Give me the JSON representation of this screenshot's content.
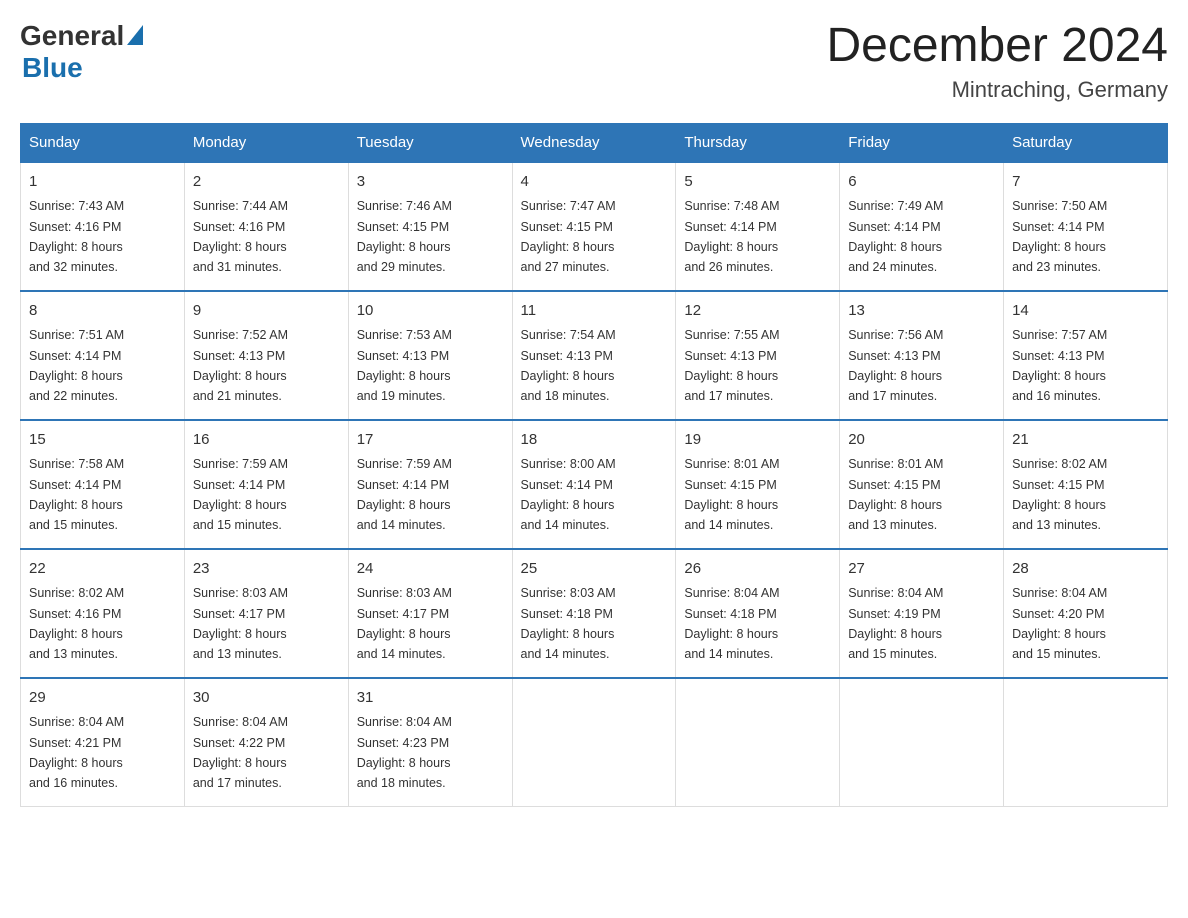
{
  "header": {
    "title": "December 2024",
    "subtitle": "Mintraching, Germany",
    "logo_general": "General",
    "logo_blue": "Blue"
  },
  "days_of_week": [
    "Sunday",
    "Monday",
    "Tuesday",
    "Wednesday",
    "Thursday",
    "Friday",
    "Saturday"
  ],
  "weeks": [
    [
      {
        "day": "1",
        "sunrise": "Sunrise: 7:43 AM",
        "sunset": "Sunset: 4:16 PM",
        "daylight": "Daylight: 8 hours",
        "daylight2": "and 32 minutes."
      },
      {
        "day": "2",
        "sunrise": "Sunrise: 7:44 AM",
        "sunset": "Sunset: 4:16 PM",
        "daylight": "Daylight: 8 hours",
        "daylight2": "and 31 minutes."
      },
      {
        "day": "3",
        "sunrise": "Sunrise: 7:46 AM",
        "sunset": "Sunset: 4:15 PM",
        "daylight": "Daylight: 8 hours",
        "daylight2": "and 29 minutes."
      },
      {
        "day": "4",
        "sunrise": "Sunrise: 7:47 AM",
        "sunset": "Sunset: 4:15 PM",
        "daylight": "Daylight: 8 hours",
        "daylight2": "and 27 minutes."
      },
      {
        "day": "5",
        "sunrise": "Sunrise: 7:48 AM",
        "sunset": "Sunset: 4:14 PM",
        "daylight": "Daylight: 8 hours",
        "daylight2": "and 26 minutes."
      },
      {
        "day": "6",
        "sunrise": "Sunrise: 7:49 AM",
        "sunset": "Sunset: 4:14 PM",
        "daylight": "Daylight: 8 hours",
        "daylight2": "and 24 minutes."
      },
      {
        "day": "7",
        "sunrise": "Sunrise: 7:50 AM",
        "sunset": "Sunset: 4:14 PM",
        "daylight": "Daylight: 8 hours",
        "daylight2": "and 23 minutes."
      }
    ],
    [
      {
        "day": "8",
        "sunrise": "Sunrise: 7:51 AM",
        "sunset": "Sunset: 4:14 PM",
        "daylight": "Daylight: 8 hours",
        "daylight2": "and 22 minutes."
      },
      {
        "day": "9",
        "sunrise": "Sunrise: 7:52 AM",
        "sunset": "Sunset: 4:13 PM",
        "daylight": "Daylight: 8 hours",
        "daylight2": "and 21 minutes."
      },
      {
        "day": "10",
        "sunrise": "Sunrise: 7:53 AM",
        "sunset": "Sunset: 4:13 PM",
        "daylight": "Daylight: 8 hours",
        "daylight2": "and 19 minutes."
      },
      {
        "day": "11",
        "sunrise": "Sunrise: 7:54 AM",
        "sunset": "Sunset: 4:13 PM",
        "daylight": "Daylight: 8 hours",
        "daylight2": "and 18 minutes."
      },
      {
        "day": "12",
        "sunrise": "Sunrise: 7:55 AM",
        "sunset": "Sunset: 4:13 PM",
        "daylight": "Daylight: 8 hours",
        "daylight2": "and 17 minutes."
      },
      {
        "day": "13",
        "sunrise": "Sunrise: 7:56 AM",
        "sunset": "Sunset: 4:13 PM",
        "daylight": "Daylight: 8 hours",
        "daylight2": "and 17 minutes."
      },
      {
        "day": "14",
        "sunrise": "Sunrise: 7:57 AM",
        "sunset": "Sunset: 4:13 PM",
        "daylight": "Daylight: 8 hours",
        "daylight2": "and 16 minutes."
      }
    ],
    [
      {
        "day": "15",
        "sunrise": "Sunrise: 7:58 AM",
        "sunset": "Sunset: 4:14 PM",
        "daylight": "Daylight: 8 hours",
        "daylight2": "and 15 minutes."
      },
      {
        "day": "16",
        "sunrise": "Sunrise: 7:59 AM",
        "sunset": "Sunset: 4:14 PM",
        "daylight": "Daylight: 8 hours",
        "daylight2": "and 15 minutes."
      },
      {
        "day": "17",
        "sunrise": "Sunrise: 7:59 AM",
        "sunset": "Sunset: 4:14 PM",
        "daylight": "Daylight: 8 hours",
        "daylight2": "and 14 minutes."
      },
      {
        "day": "18",
        "sunrise": "Sunrise: 8:00 AM",
        "sunset": "Sunset: 4:14 PM",
        "daylight": "Daylight: 8 hours",
        "daylight2": "and 14 minutes."
      },
      {
        "day": "19",
        "sunrise": "Sunrise: 8:01 AM",
        "sunset": "Sunset: 4:15 PM",
        "daylight": "Daylight: 8 hours",
        "daylight2": "and 14 minutes."
      },
      {
        "day": "20",
        "sunrise": "Sunrise: 8:01 AM",
        "sunset": "Sunset: 4:15 PM",
        "daylight": "Daylight: 8 hours",
        "daylight2": "and 13 minutes."
      },
      {
        "day": "21",
        "sunrise": "Sunrise: 8:02 AM",
        "sunset": "Sunset: 4:15 PM",
        "daylight": "Daylight: 8 hours",
        "daylight2": "and 13 minutes."
      }
    ],
    [
      {
        "day": "22",
        "sunrise": "Sunrise: 8:02 AM",
        "sunset": "Sunset: 4:16 PM",
        "daylight": "Daylight: 8 hours",
        "daylight2": "and 13 minutes."
      },
      {
        "day": "23",
        "sunrise": "Sunrise: 8:03 AM",
        "sunset": "Sunset: 4:17 PM",
        "daylight": "Daylight: 8 hours",
        "daylight2": "and 13 minutes."
      },
      {
        "day": "24",
        "sunrise": "Sunrise: 8:03 AM",
        "sunset": "Sunset: 4:17 PM",
        "daylight": "Daylight: 8 hours",
        "daylight2": "and 14 minutes."
      },
      {
        "day": "25",
        "sunrise": "Sunrise: 8:03 AM",
        "sunset": "Sunset: 4:18 PM",
        "daylight": "Daylight: 8 hours",
        "daylight2": "and 14 minutes."
      },
      {
        "day": "26",
        "sunrise": "Sunrise: 8:04 AM",
        "sunset": "Sunset: 4:18 PM",
        "daylight": "Daylight: 8 hours",
        "daylight2": "and 14 minutes."
      },
      {
        "day": "27",
        "sunrise": "Sunrise: 8:04 AM",
        "sunset": "Sunset: 4:19 PM",
        "daylight": "Daylight: 8 hours",
        "daylight2": "and 15 minutes."
      },
      {
        "day": "28",
        "sunrise": "Sunrise: 8:04 AM",
        "sunset": "Sunset: 4:20 PM",
        "daylight": "Daylight: 8 hours",
        "daylight2": "and 15 minutes."
      }
    ],
    [
      {
        "day": "29",
        "sunrise": "Sunrise: 8:04 AM",
        "sunset": "Sunset: 4:21 PM",
        "daylight": "Daylight: 8 hours",
        "daylight2": "and 16 minutes."
      },
      {
        "day": "30",
        "sunrise": "Sunrise: 8:04 AM",
        "sunset": "Sunset: 4:22 PM",
        "daylight": "Daylight: 8 hours",
        "daylight2": "and 17 minutes."
      },
      {
        "day": "31",
        "sunrise": "Sunrise: 8:04 AM",
        "sunset": "Sunset: 4:23 PM",
        "daylight": "Daylight: 8 hours",
        "daylight2": "and 18 minutes."
      },
      {
        "day": "",
        "sunrise": "",
        "sunset": "",
        "daylight": "",
        "daylight2": ""
      },
      {
        "day": "",
        "sunrise": "",
        "sunset": "",
        "daylight": "",
        "daylight2": ""
      },
      {
        "day": "",
        "sunrise": "",
        "sunset": "",
        "daylight": "",
        "daylight2": ""
      },
      {
        "day": "",
        "sunrise": "",
        "sunset": "",
        "daylight": "",
        "daylight2": ""
      }
    ]
  ]
}
